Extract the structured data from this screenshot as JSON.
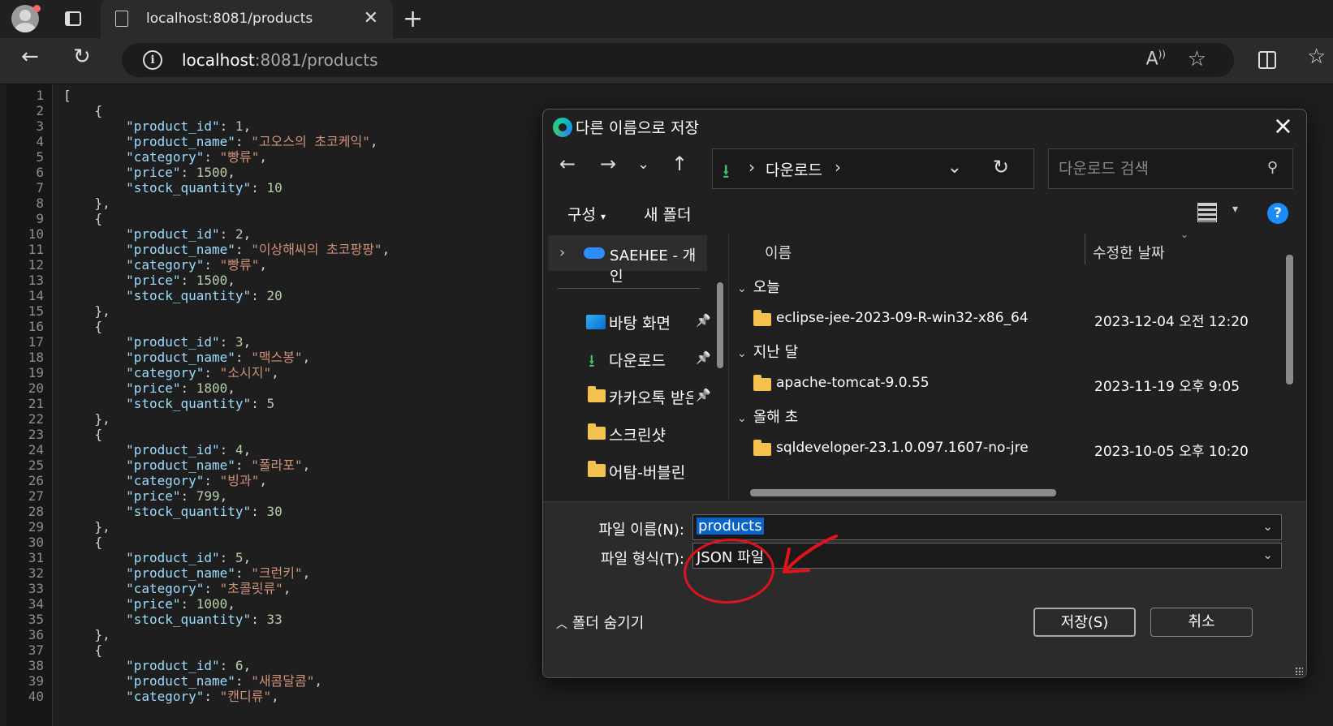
{
  "browser": {
    "tab_title": "localhost:8081/products",
    "url_host": "localhost",
    "url_rest": ":8081/products"
  },
  "code": {
    "lines": [
      [
        [
          "p",
          "["
        ]
      ],
      [
        [
          "p",
          "    {"
        ]
      ],
      [
        [
          "p",
          "        "
        ],
        [
          "k",
          "\"product_id\""
        ],
        [
          "p",
          ": "
        ],
        [
          "n",
          "1"
        ],
        [
          "p",
          ","
        ]
      ],
      [
        [
          "p",
          "        "
        ],
        [
          "k",
          "\"product_name\""
        ],
        [
          "p",
          ": "
        ],
        [
          "s",
          "\"고오스의 초코케익\""
        ],
        [
          "p",
          ","
        ]
      ],
      [
        [
          "p",
          "        "
        ],
        [
          "k",
          "\"category\""
        ],
        [
          "p",
          ": "
        ],
        [
          "s",
          "\"빵류\""
        ],
        [
          "p",
          ","
        ]
      ],
      [
        [
          "p",
          "        "
        ],
        [
          "k",
          "\"price\""
        ],
        [
          "p",
          ": "
        ],
        [
          "n",
          "1500"
        ],
        [
          "p",
          ","
        ]
      ],
      [
        [
          "p",
          "        "
        ],
        [
          "k",
          "\"stock_quantity\""
        ],
        [
          "p",
          ": "
        ],
        [
          "n",
          "10"
        ]
      ],
      [
        [
          "p",
          "    },"
        ]
      ],
      [
        [
          "p",
          "    {"
        ]
      ],
      [
        [
          "p",
          "        "
        ],
        [
          "k",
          "\"product_id\""
        ],
        [
          "p",
          ": "
        ],
        [
          "n",
          "2"
        ],
        [
          "p",
          ","
        ]
      ],
      [
        [
          "p",
          "        "
        ],
        [
          "k",
          "\"product_name\""
        ],
        [
          "p",
          ": "
        ],
        [
          "s",
          "\"이상해씨의 초코팡팡\""
        ],
        [
          "p",
          ","
        ]
      ],
      [
        [
          "p",
          "        "
        ],
        [
          "k",
          "\"category\""
        ],
        [
          "p",
          ": "
        ],
        [
          "s",
          "\"빵류\""
        ],
        [
          "p",
          ","
        ]
      ],
      [
        [
          "p",
          "        "
        ],
        [
          "k",
          "\"price\""
        ],
        [
          "p",
          ": "
        ],
        [
          "n",
          "1500"
        ],
        [
          "p",
          ","
        ]
      ],
      [
        [
          "p",
          "        "
        ],
        [
          "k",
          "\"stock_quantity\""
        ],
        [
          "p",
          ": "
        ],
        [
          "n",
          "20"
        ]
      ],
      [
        [
          "p",
          "    },"
        ]
      ],
      [
        [
          "p",
          "    {"
        ]
      ],
      [
        [
          "p",
          "        "
        ],
        [
          "k",
          "\"product_id\""
        ],
        [
          "p",
          ": "
        ],
        [
          "n",
          "3"
        ],
        [
          "p",
          ","
        ]
      ],
      [
        [
          "p",
          "        "
        ],
        [
          "k",
          "\"product_name\""
        ],
        [
          "p",
          ": "
        ],
        [
          "s",
          "\"맥스봉\""
        ],
        [
          "p",
          ","
        ]
      ],
      [
        [
          "p",
          "        "
        ],
        [
          "k",
          "\"category\""
        ],
        [
          "p",
          ": "
        ],
        [
          "s",
          "\"소시지\""
        ],
        [
          "p",
          ","
        ]
      ],
      [
        [
          "p",
          "        "
        ],
        [
          "k",
          "\"price\""
        ],
        [
          "p",
          ": "
        ],
        [
          "n",
          "1800"
        ],
        [
          "p",
          ","
        ]
      ],
      [
        [
          "p",
          "        "
        ],
        [
          "k",
          "\"stock_quantity\""
        ],
        [
          "p",
          ": "
        ],
        [
          "n",
          "5"
        ]
      ],
      [
        [
          "p",
          "    },"
        ]
      ],
      [
        [
          "p",
          "    {"
        ]
      ],
      [
        [
          "p",
          "        "
        ],
        [
          "k",
          "\"product_id\""
        ],
        [
          "p",
          ": "
        ],
        [
          "n",
          "4"
        ],
        [
          "p",
          ","
        ]
      ],
      [
        [
          "p",
          "        "
        ],
        [
          "k",
          "\"product_name\""
        ],
        [
          "p",
          ": "
        ],
        [
          "s",
          "\"폴라포\""
        ],
        [
          "p",
          ","
        ]
      ],
      [
        [
          "p",
          "        "
        ],
        [
          "k",
          "\"category\""
        ],
        [
          "p",
          ": "
        ],
        [
          "s",
          "\"빙과\""
        ],
        [
          "p",
          ","
        ]
      ],
      [
        [
          "p",
          "        "
        ],
        [
          "k",
          "\"price\""
        ],
        [
          "p",
          ": "
        ],
        [
          "n",
          "799"
        ],
        [
          "p",
          ","
        ]
      ],
      [
        [
          "p",
          "        "
        ],
        [
          "k",
          "\"stock_quantity\""
        ],
        [
          "p",
          ": "
        ],
        [
          "n",
          "30"
        ]
      ],
      [
        [
          "p",
          "    },"
        ]
      ],
      [
        [
          "p",
          "    {"
        ]
      ],
      [
        [
          "p",
          "        "
        ],
        [
          "k",
          "\"product_id\""
        ],
        [
          "p",
          ": "
        ],
        [
          "n",
          "5"
        ],
        [
          "p",
          ","
        ]
      ],
      [
        [
          "p",
          "        "
        ],
        [
          "k",
          "\"product_name\""
        ],
        [
          "p",
          ": "
        ],
        [
          "s",
          "\"크런키\""
        ],
        [
          "p",
          ","
        ]
      ],
      [
        [
          "p",
          "        "
        ],
        [
          "k",
          "\"category\""
        ],
        [
          "p",
          ": "
        ],
        [
          "s",
          "\"초콜릿류\""
        ],
        [
          "p",
          ","
        ]
      ],
      [
        [
          "p",
          "        "
        ],
        [
          "k",
          "\"price\""
        ],
        [
          "p",
          ": "
        ],
        [
          "n",
          "1000"
        ],
        [
          "p",
          ","
        ]
      ],
      [
        [
          "p",
          "        "
        ],
        [
          "k",
          "\"stock_quantity\""
        ],
        [
          "p",
          ": "
        ],
        [
          "n",
          "33"
        ]
      ],
      [
        [
          "p",
          "    },"
        ]
      ],
      [
        [
          "p",
          "    {"
        ]
      ],
      [
        [
          "p",
          "        "
        ],
        [
          "k",
          "\"product_id\""
        ],
        [
          "p",
          ": "
        ],
        [
          "n",
          "6"
        ],
        [
          "p",
          ","
        ]
      ],
      [
        [
          "p",
          "        "
        ],
        [
          "k",
          "\"product_name\""
        ],
        [
          "p",
          ": "
        ],
        [
          "s",
          "\"새콤달콤\""
        ],
        [
          "p",
          ","
        ]
      ],
      [
        [
          "p",
          "        "
        ],
        [
          "k",
          "\"category\""
        ],
        [
          "p",
          ": "
        ],
        [
          "s",
          "\"캔디류\""
        ],
        [
          "p",
          ","
        ]
      ]
    ]
  },
  "dialog": {
    "title": "다른 이름으로 저장",
    "breadcrumb": "다운로드",
    "search_placeholder": "다운로드 검색",
    "organize_label": "구성",
    "new_folder_label": "새 폴더",
    "sidebar_top": "SAEHEE - 개인",
    "sidebar_items": [
      {
        "label": "바탕 화면",
        "icon": "desktop-icon",
        "pinned": true
      },
      {
        "label": "다운로드",
        "icon": "download-icon",
        "pinned": true
      },
      {
        "label": "카카오톡 받은",
        "icon": "folder-icon",
        "pinned": true
      },
      {
        "label": "스크린샷",
        "icon": "folder-icon",
        "pinned": false
      },
      {
        "label": "어탐-버블린",
        "icon": "folder-icon",
        "pinned": false
      }
    ],
    "col_name": "이름",
    "col_date": "수정한 날짜",
    "groups": [
      {
        "label": "오늘",
        "files": [
          {
            "name": "eclipse-jee-2023-09-R-win32-x86_64",
            "date": "2023-12-04 오전 12:20"
          }
        ]
      },
      {
        "label": "지난 달",
        "files": [
          {
            "name": "apache-tomcat-9.0.55",
            "date": "2023-11-19 오후 9:05"
          }
        ]
      },
      {
        "label": "올해 초",
        "files": [
          {
            "name": "sqldeveloper-23.1.0.097.1607-no-jre",
            "date": "2023-10-05 오후 10:20"
          }
        ]
      }
    ],
    "filename_label": "파일 이름(N):",
    "filename_value": "products",
    "filetype_label": "파일 형식(T):",
    "filetype_value": "JSON 파일",
    "hide_folders_label": "폴더 숨기기",
    "save_label": "저장(S)",
    "cancel_label": "취소"
  },
  "annotation_color": "#e0121c"
}
